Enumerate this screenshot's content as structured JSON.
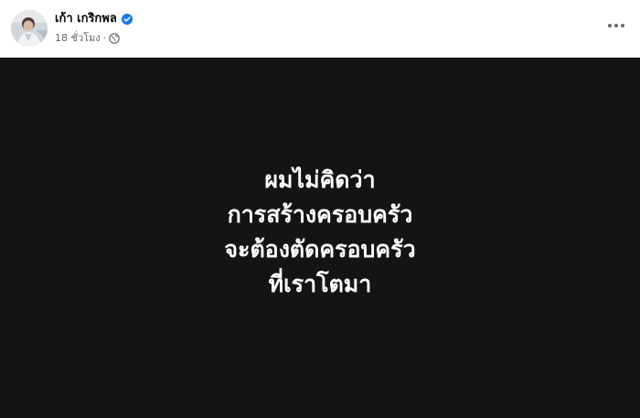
{
  "author": {
    "name": "เก้า เกริกพล",
    "verified": true
  },
  "meta": {
    "time": "18 ชั่วโมง",
    "separator": "·",
    "audience_icon": "globe-icon"
  },
  "actions": {
    "more_icon": "more-horizontal-icon"
  },
  "post_image": {
    "background": "#141414",
    "text_color": "#ffffff",
    "lines": [
      "ผมไม่คิดว่า",
      "การสร้างครอบครัว",
      "จะต้องตัดครอบครัว",
      "ที่เราโตมา"
    ]
  },
  "colors": {
    "verified_badge": "#1877f2",
    "secondary_text": "#65676b",
    "primary_text": "#050505"
  }
}
